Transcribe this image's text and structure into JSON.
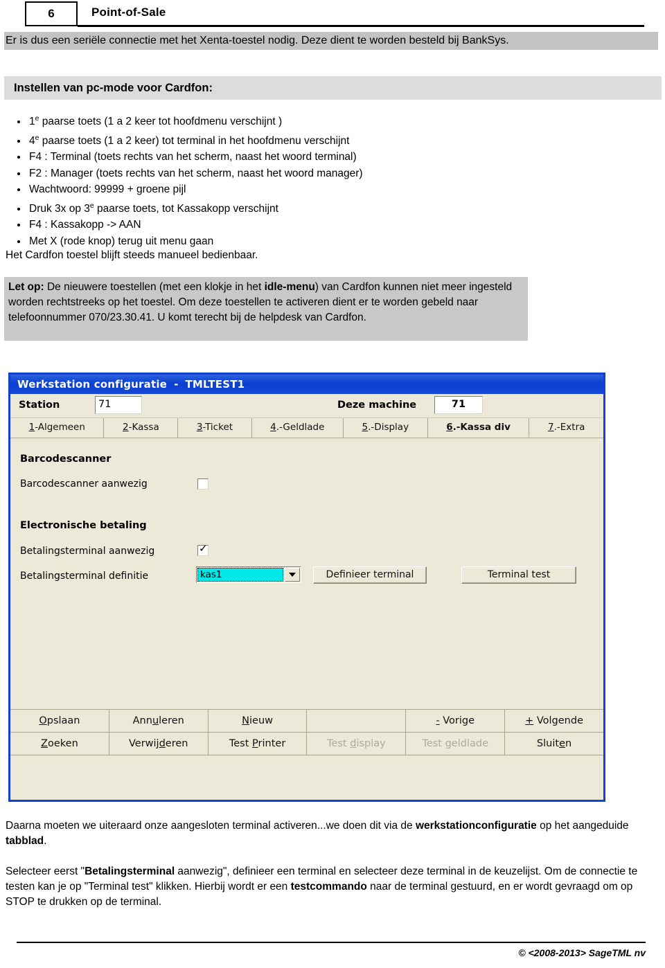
{
  "header": {
    "page_number": "6",
    "title": "Point-of-Sale"
  },
  "intro_band": "Er is dus een seriële connectie met het Xenta-toestel nodig. Deze dient te worden besteld bij BankSys.",
  "section_heading": "Instellen van pc-mode voor Cardfon:",
  "bullets": [
    {
      "pre": "1",
      "sup": "e",
      "post": " paarse toets (1 a 2 keer  tot hoofdmenu verschijnt )"
    },
    {
      "pre": "4",
      "sup": "e",
      "post": " paarse toets (1 a 2 keer)  tot  terminal in het hoofdmenu verschijnt"
    },
    {
      "pre": "F4 : Terminal   (toets rechts van het scherm, naast het woord terminal)",
      "sup": "",
      "post": ""
    },
    {
      "pre": "F2 : Manager   (toets rechts van het scherm, naast het woord manager)",
      "sup": "",
      "post": ""
    },
    {
      "pre": "Wachtwoord: 99999  + groene pijl",
      "sup": "",
      "post": ""
    },
    {
      "pre": "Druk 3x op 3",
      "sup": "e",
      "post": " paarse toets, tot Kassakopp verschijnt"
    },
    {
      "pre": "F4 : Kassakopp ->  AAN",
      "sup": "",
      "post": ""
    },
    {
      "pre": "Met X (rode knop) terug uit menu gaan",
      "sup": "",
      "post": ""
    }
  ],
  "para_manueel": "Het Cardfon toestel blijft steeds manueel bedienbaar.",
  "letop": {
    "label": "Let op:",
    "text_a": " De nieuwere toestellen (met een klokje in het ",
    "bold_a": "idle-menu",
    "text_b": ") van Cardfon kunnen niet meer ingesteld worden rechtstreeks op het toestel. Om deze toestellen te activeren dient er te worden gebeld naar telefoonnummer 070/23.30.41. U komt terecht bij de helpdesk van Cardfon."
  },
  "dialog": {
    "title": "Werkstation configuratie",
    "title_separator": "-",
    "title_suffix": "TMLTEST1",
    "station_label": "Station",
    "station_value": "71",
    "deze_machine_label": "Deze machine",
    "deze_machine_value": "71",
    "tabs": [
      {
        "accel": "1",
        "rest": "-Algemeen",
        "active": false
      },
      {
        "accel": "2",
        "rest": "-Kassa",
        "active": false
      },
      {
        "accel": "3",
        "rest": "-Ticket",
        "active": false
      },
      {
        "accel": "4",
        "rest": ".-Geldlade",
        "active": false
      },
      {
        "accel": "5",
        "rest": ".-Display",
        "active": false
      },
      {
        "accel": "6",
        "rest": ".-Kassa div",
        "active": true
      },
      {
        "accel": "7",
        "rest": ".-Extra",
        "active": false
      }
    ],
    "group_barcode_title": "Barcodescanner",
    "barcode_present_label": "Barcodescanner aanwezig",
    "barcode_present_checked": false,
    "group_payment_title": "Electronische betaling",
    "terminal_present_label": "Betalingsterminal aanwezig",
    "terminal_present_checked": true,
    "terminal_def_label": "Betalingsterminal definitie",
    "terminal_def_value": "kas1",
    "btn_define_terminal": "Definieer terminal",
    "btn_terminal_test": "Terminal test",
    "bottom_buttons_row1": [
      {
        "accel": "O",
        "pre": "",
        "rest": "pslaan",
        "state": "enabled"
      },
      {
        "accel": "u",
        "pre": "Ann",
        "rest": "leren",
        "state": "enabled"
      },
      {
        "accel": "N",
        "pre": "",
        "rest": "ieuw",
        "state": "enabled"
      },
      {
        "accel": "",
        "pre": "",
        "rest": "",
        "state": "blank"
      },
      {
        "accel": "-",
        "pre": "",
        "rest": " Vorige",
        "state": "enabled"
      },
      {
        "accel": "+",
        "pre": "",
        "rest": " Volgende",
        "state": "enabled"
      }
    ],
    "bottom_buttons_row2": [
      {
        "accel": "Z",
        "pre": "",
        "rest": "oeken",
        "state": "enabled"
      },
      {
        "accel": "d",
        "pre": "Verwij",
        "rest": "eren",
        "state": "enabled"
      },
      {
        "accel": "P",
        "pre": "Test ",
        "rest": "rinter",
        "state": "enabled"
      },
      {
        "accel": "d",
        "pre": "Test ",
        "rest": "isplay",
        "state": "disabled"
      },
      {
        "accel": "",
        "pre": "Test geldlade",
        "rest": "",
        "state": "disabled"
      },
      {
        "accel": "e",
        "pre": "Sluit",
        "rest": "n",
        "state": "enabled"
      }
    ]
  },
  "tail1": {
    "a": "Daarna moeten we uiteraard onze aangesloten terminal activeren...we doen dit via de ",
    "b": "werkstationconfiguratie",
    "c": " op het aangeduide ",
    "d": "tabblad",
    "e": "."
  },
  "tail2": {
    "a": "Selecteer eerst \"",
    "b": "Betalingsterminal",
    "c": " aanwezig\", definieer een terminal en selecteer deze terminal in de keuzelijst. Om de connectie te testen kan je op \"Terminal test\" klikken. Hierbij wordt er een ",
    "d": "testcommando",
    "e": " naar de terminal gestuurd, en er wordt gevraagd om op STOP te drukken op de terminal."
  },
  "footer": "© <2008-2013> SageTML nv",
  "colors": {
    "title_bar": "#0b3fd0",
    "dialog_face": "#ece9d8",
    "combo_selection": "#00e7e7",
    "band_intro": "#c3c3c3",
    "band_heading": "#dcdcdc",
    "letop_box": "#c8c8c8"
  }
}
